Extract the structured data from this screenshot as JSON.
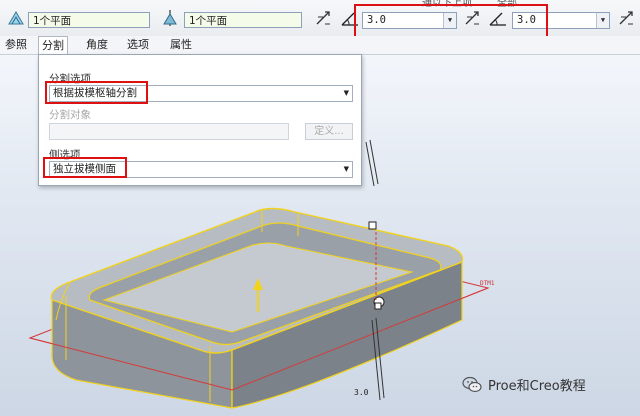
{
  "toolbar": {
    "plane_field_1": "1个平面",
    "plane_field_2": "1个平面",
    "truncated_top_text_1": "通以下上项",
    "truncated_top_text_2": "全部",
    "angle_1": {
      "value": "3.0"
    },
    "angle_2": {
      "value": "3.0"
    }
  },
  "tabs": [
    {
      "label": "参照"
    },
    {
      "label": "分割"
    },
    {
      "label": "角度"
    },
    {
      "label": "选项"
    },
    {
      "label": "属性"
    }
  ],
  "split_panel": {
    "split_options_label": "分割选项",
    "split_options_value": "根据拔模枢轴分割",
    "split_object_label": "分割对象",
    "define_button": "定义...",
    "side_options_label": "侧选项",
    "side_options_value": "独立拔模侧面"
  },
  "viewport": {
    "datum_label": "DTM1",
    "dimension_label": "3.0",
    "watermark": "Proe和Creo教程"
  },
  "colors": {
    "highlight_red": "#dd1111",
    "edge_yellow": "#f1d21c",
    "plane_red": "#d43a3a",
    "model_gray": "#a7adb4"
  }
}
